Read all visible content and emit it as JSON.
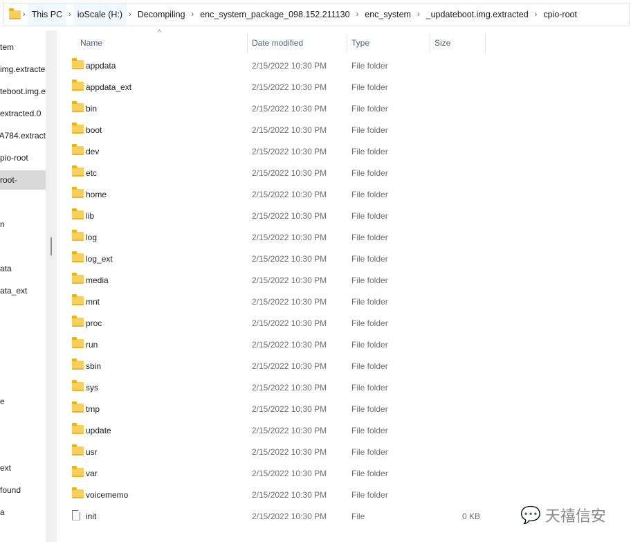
{
  "breadcrumb": [
    "This PC",
    "ioScale (H:)",
    "Decompiling",
    "enc_system_package_098.152.211130",
    "enc_system",
    "_updateboot.img.extracted",
    "cpio-root"
  ],
  "sidebar": [
    {
      "label": "tem",
      "y": 0
    },
    {
      "label": "img.extracte"
    },
    {
      "label": "teboot.img.e"
    },
    {
      "label": "0.extracted"
    },
    {
      "label": "A784.extract"
    },
    {
      "label": "pio-root"
    },
    {
      "label": "-root",
      "selected": true
    },
    {
      "label": ""
    },
    {
      "label": "n"
    },
    {
      "label": ""
    },
    {
      "label": "ata"
    },
    {
      "label": "ata_ext"
    },
    {
      "label": ""
    },
    {
      "label": ""
    },
    {
      "label": ""
    },
    {
      "label": ""
    },
    {
      "label": "e"
    },
    {
      "label": ""
    },
    {
      "label": ""
    },
    {
      "label": "ext"
    },
    {
      "label": "found"
    },
    {
      "label": "a"
    }
  ],
  "columns": {
    "name": "Name",
    "date": "Date modified",
    "type": "Type",
    "size": "Size"
  },
  "files": [
    {
      "name": "appdata",
      "date": "2/15/2022 10:30 PM",
      "type": "File folder",
      "size": "",
      "icon": "folder"
    },
    {
      "name": "appdata_ext",
      "date": "2/15/2022 10:30 PM",
      "type": "File folder",
      "size": "",
      "icon": "folder"
    },
    {
      "name": "bin",
      "date": "2/15/2022 10:30 PM",
      "type": "File folder",
      "size": "",
      "icon": "folder"
    },
    {
      "name": "boot",
      "date": "2/15/2022 10:30 PM",
      "type": "File folder",
      "size": "",
      "icon": "folder"
    },
    {
      "name": "dev",
      "date": "2/15/2022 10:30 PM",
      "type": "File folder",
      "size": "",
      "icon": "folder"
    },
    {
      "name": "etc",
      "date": "2/15/2022 10:30 PM",
      "type": "File folder",
      "size": "",
      "icon": "folder"
    },
    {
      "name": "home",
      "date": "2/15/2022 10:30 PM",
      "type": "File folder",
      "size": "",
      "icon": "folder"
    },
    {
      "name": "lib",
      "date": "2/15/2022 10:30 PM",
      "type": "File folder",
      "size": "",
      "icon": "folder"
    },
    {
      "name": "log",
      "date": "2/15/2022 10:30 PM",
      "type": "File folder",
      "size": "",
      "icon": "folder"
    },
    {
      "name": "log_ext",
      "date": "2/15/2022 10:30 PM",
      "type": "File folder",
      "size": "",
      "icon": "folder"
    },
    {
      "name": "media",
      "date": "2/15/2022 10:30 PM",
      "type": "File folder",
      "size": "",
      "icon": "folder"
    },
    {
      "name": "mnt",
      "date": "2/15/2022 10:30 PM",
      "type": "File folder",
      "size": "",
      "icon": "folder"
    },
    {
      "name": "proc",
      "date": "2/15/2022 10:30 PM",
      "type": "File folder",
      "size": "",
      "icon": "folder"
    },
    {
      "name": "run",
      "date": "2/15/2022 10:30 PM",
      "type": "File folder",
      "size": "",
      "icon": "folder"
    },
    {
      "name": "sbin",
      "date": "2/15/2022 10:30 PM",
      "type": "File folder",
      "size": "",
      "icon": "folder"
    },
    {
      "name": "sys",
      "date": "2/15/2022 10:30 PM",
      "type": "File folder",
      "size": "",
      "icon": "folder"
    },
    {
      "name": "tmp",
      "date": "2/15/2022 10:30 PM",
      "type": "File folder",
      "size": "",
      "icon": "folder"
    },
    {
      "name": "update",
      "date": "2/15/2022 10:30 PM",
      "type": "File folder",
      "size": "",
      "icon": "folder"
    },
    {
      "name": "usr",
      "date": "2/15/2022 10:30 PM",
      "type": "File folder",
      "size": "",
      "icon": "folder"
    },
    {
      "name": "var",
      "date": "2/15/2022 10:30 PM",
      "type": "File folder",
      "size": "",
      "icon": "folder"
    },
    {
      "name": "voicememo",
      "date": "2/15/2022 10:30 PM",
      "type": "File folder",
      "size": "",
      "icon": "folder"
    },
    {
      "name": "init",
      "date": "2/15/2022 10:30 PM",
      "type": "File",
      "size": "0 KB",
      "icon": "file"
    }
  ],
  "watermark": "天禧信安"
}
